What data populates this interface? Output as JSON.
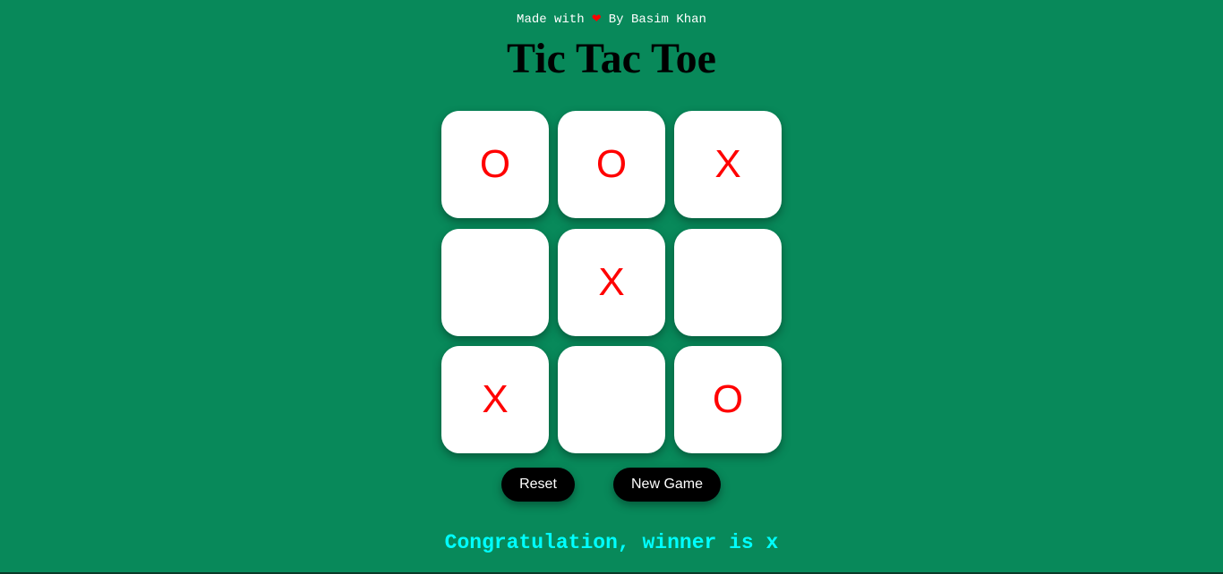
{
  "credit": {
    "prefix": "Made with",
    "heart": "❤",
    "suffix": "By Basim Khan"
  },
  "title": "Tic Tac Toe",
  "board": [
    "O",
    "O",
    "X",
    "",
    "X",
    "",
    "X",
    "",
    "O"
  ],
  "buttons": {
    "reset": "Reset",
    "new_game": "New Game"
  },
  "message": "Congratulation, winner is x",
  "colors": {
    "background": "#08895a",
    "mark": "#ff0000",
    "message": "#00ffff"
  }
}
